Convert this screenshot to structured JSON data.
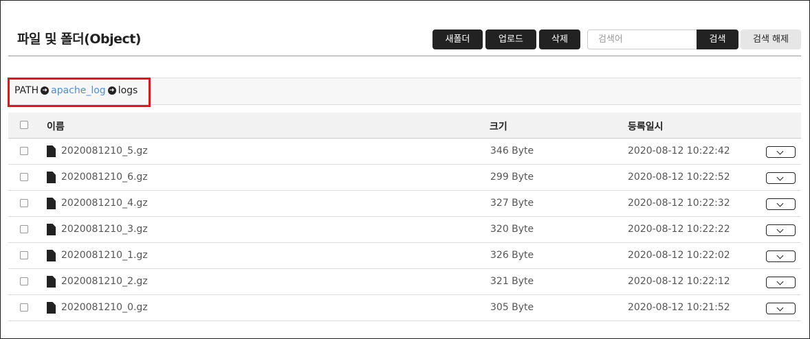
{
  "page": {
    "title": "파일 및 폴더(Object)"
  },
  "toolbar": {
    "new_folder": "새폴더",
    "upload": "업로드",
    "delete": "삭제",
    "search_placeholder": "검색어",
    "search_value": "",
    "search": "검색",
    "search_reset": "검색 해제"
  },
  "path": {
    "label": "PATH",
    "segments": [
      "apache_log",
      "logs"
    ]
  },
  "table": {
    "columns": {
      "name": "이름",
      "size": "크기",
      "date": "등록일시"
    },
    "rows": [
      {
        "name": "2020081210_5.gz",
        "size": "346 Byte",
        "date": "2020-08-12 10:22:42"
      },
      {
        "name": "2020081210_6.gz",
        "size": "299 Byte",
        "date": "2020-08-12 10:22:52"
      },
      {
        "name": "2020081210_4.gz",
        "size": "327 Byte",
        "date": "2020-08-12 10:22:32"
      },
      {
        "name": "2020081210_3.gz",
        "size": "320 Byte",
        "date": "2020-08-12 10:22:22"
      },
      {
        "name": "2020081210_1.gz",
        "size": "326 Byte",
        "date": "2020-08-12 10:22:02"
      },
      {
        "name": "2020081210_2.gz",
        "size": "321 Byte",
        "date": "2020-08-12 10:22:12"
      },
      {
        "name": "2020081210_0.gz",
        "size": "305 Byte",
        "date": "2020-08-12 10:21:52"
      }
    ]
  },
  "colors": {
    "button_dark": "#222222",
    "link": "#4a90d9",
    "highlight_border": "#ee1111"
  },
  "icons": {
    "path_arrow": "arrow-circle-right-icon",
    "file": "file-icon",
    "row_menu": "chevron-down-icon"
  }
}
